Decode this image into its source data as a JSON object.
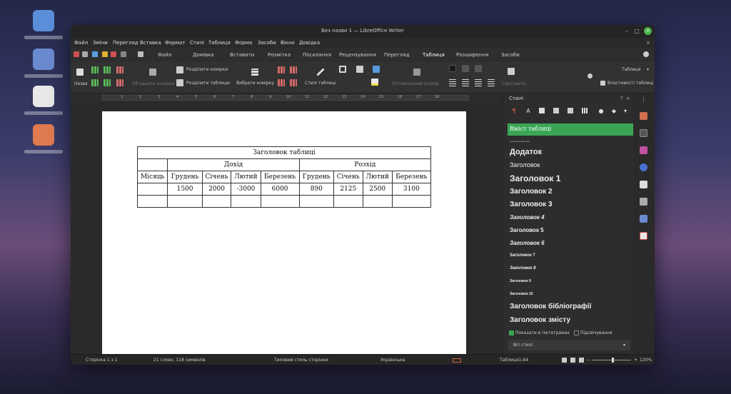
{
  "window": {
    "title": "Без назви 1 — LibreOffice Writer",
    "minimize": "–",
    "maximize": "□",
    "close": "×",
    "doc_close": "×"
  },
  "menu": [
    "Файл",
    "Зміни",
    "Перегляд",
    "Вставка",
    "Формат",
    "Стилі",
    "Таблиця",
    "Форма",
    "Засоби",
    "Вікно",
    "Довідка"
  ],
  "tabs": [
    "Файл",
    "Домівка",
    "Вставити",
    "Розмітка",
    "Посилання",
    "Рецензування",
    "Перегляд",
    "Таблиця",
    "Розширення",
    "Засоби"
  ],
  "active_tab": "Таблиця",
  "ribbon": {
    "name_label": "Назва",
    "merge_cells": "Об'єднати комірки",
    "split_cells": "Розділити комірки",
    "split_table": "Розділити таблицю",
    "select_cell": "Вибрати комірку",
    "table_styles": "Стилі таблиці",
    "optimal_size": "Оптимальний розмір",
    "sort": "Сортувати",
    "table_dropdown": "Таблиця",
    "table_properties": "Властивості таблиці"
  },
  "ruler_numbers": [
    "1",
    "2",
    "3",
    "4",
    "5",
    "6",
    "7",
    "8",
    "9",
    "10",
    "11",
    "12",
    "13",
    "14",
    "15",
    "16",
    "17",
    "18"
  ],
  "table": {
    "title": "Заголовок таблиці",
    "group_income": "Дохід",
    "group_expense": "Розхід",
    "col_month": "Місяць",
    "headers_income": [
      "Грудень",
      "Січень",
      "Лютий",
      "Березень"
    ],
    "headers_expense": [
      "Грудень",
      "Січень",
      "Лютий",
      "Березень"
    ],
    "row_income": [
      "1500",
      "2000",
      "-3000",
      "6000"
    ],
    "row_expense": [
      "890",
      "2125",
      "2500",
      "3100"
    ]
  },
  "sidebar": {
    "title": "Стилі",
    "help": "?",
    "close": "×",
    "styles": [
      "Вміст таблиці",
      "Горизонтальна лінія",
      "Додаток",
      "Заголовок",
      "Заголовок 1",
      "Заголовок 2",
      "Заголовок 3",
      "Заголовок 4",
      "Заголовок 5",
      "Заголовок 6",
      "Заголовок 7",
      "Заголовок 8",
      "Заголовок 9",
      "Заголовок 10",
      "Заголовок бібліографії",
      "Заголовок змісту"
    ],
    "show_previews": "Показати в піктограмах",
    "highlight": "Підсвічування",
    "filter": "Всі стилі",
    "filter_arrow": "▾"
  },
  "status": {
    "page": "Сторінка 1 з 1",
    "words": "21 слово, 118 символів",
    "page_style": "Типовий стиль сторінки",
    "language": "Українська",
    "table_cell": "Таблиця1:A4",
    "zoom_minus": "−",
    "zoom_plus": "+",
    "zoom": "120%"
  },
  "colors": {
    "accent": "#3aa655",
    "titlebar": "#242424",
    "page": "#ffffff"
  }
}
